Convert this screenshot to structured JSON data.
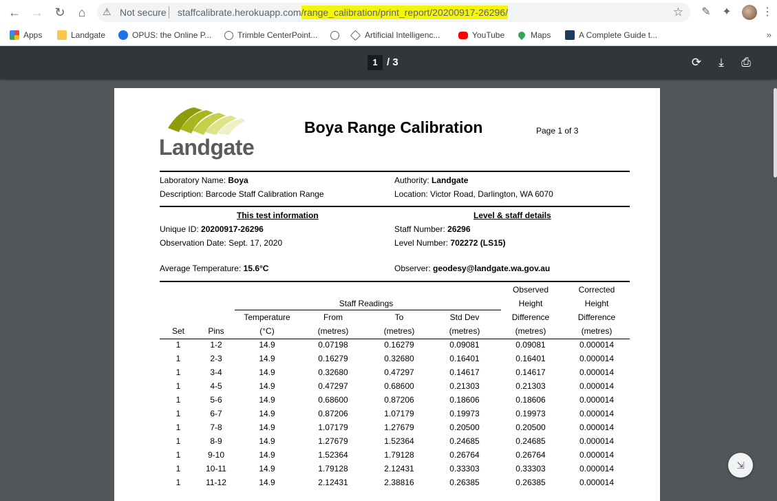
{
  "browser": {
    "security_label": "Not secure",
    "url_host": "staffcalibrate.herokuapp.com",
    "url_path": "/range_calibration/print_report/20200917-26296/",
    "bookmarks": [
      {
        "label": "Apps",
        "color": "#ea4335"
      },
      {
        "label": "Landgate",
        "color": "#f9c74f"
      },
      {
        "label": "OPUS: the Online P...",
        "color": "#1a73e8"
      },
      {
        "label": "Trimble CenterPoint...",
        "color": "#5f6368"
      },
      {
        "label": "",
        "color": "#5f6368"
      },
      {
        "label": "Artificial Intelligenc...",
        "color": "#5f6368"
      },
      {
        "label": "YouTube",
        "color": "#ff0000"
      },
      {
        "label": "Maps",
        "color": "#34a853"
      },
      {
        "label": "A Complete Guide t...",
        "color": "#1f3a5f"
      }
    ],
    "bookmarks_more": "»"
  },
  "pdf_viewer": {
    "current_page": "1",
    "total_pages": "/ 3"
  },
  "report": {
    "logo_text": "Landgate",
    "title": "Boya Range Calibration",
    "page_label": "Page 1 of 3",
    "lab_name_label": "Laboratory Name:",
    "lab_name": "Boya",
    "authority_label": "Authority:",
    "authority": "Landgate",
    "description_label": "Description:",
    "description": "Barcode Staff Calibration Range",
    "location_label": "Location:",
    "location": "Victor Road, Darlington, WA 6070",
    "test_info_heading": "This test information",
    "level_staff_heading": "Level & staff details",
    "unique_id_label": "Unique ID:",
    "unique_id": "20200917-26296",
    "staff_number_label": "Staff Number:",
    "staff_number": "26296",
    "obs_date_label": "Observation Date:",
    "obs_date": "Sept. 17, 2020",
    "level_number_label": "Level Number:",
    "level_number": "702272 (LS15)",
    "avg_temp_label": "Average Temperature:",
    "avg_temp": "15.6°C",
    "observer_label": "Observer:",
    "observer": "geodesy@landgate.wa.gov.au",
    "table": {
      "staff_readings": "Staff Readings",
      "h_set": "Set",
      "h_pins": "Pins",
      "h_temp_1": "Temperature",
      "h_temp_2": "(°C)",
      "h_from_1": "From",
      "h_from_2": "(metres)",
      "h_to_1": "To",
      "h_to_2": "(metres)",
      "h_std_1": "Std Dev",
      "h_std_2": "(metres)",
      "h_obs_1": "Observed",
      "h_obs_2": "Height",
      "h_obs_3": "Difference",
      "h_obs_4": "(metres)",
      "h_cor_1": "Corrected",
      "h_cor_2": "Height",
      "h_cor_3": "Difference",
      "h_cor_4": "(metres)",
      "rows": [
        [
          "1",
          "1-2",
          "14.9",
          "0.07198",
          "0.16279",
          "0.09081",
          "0.09081",
          "0.000014"
        ],
        [
          "1",
          "2-3",
          "14.9",
          "0.16279",
          "0.32680",
          "0.16401",
          "0.16401",
          "0.000014"
        ],
        [
          "1",
          "3-4",
          "14.9",
          "0.32680",
          "0.47297",
          "0.14617",
          "0.14617",
          "0.000014"
        ],
        [
          "1",
          "4-5",
          "14.9",
          "0.47297",
          "0.68600",
          "0.21303",
          "0.21303",
          "0.000014"
        ],
        [
          "1",
          "5-6",
          "14.9",
          "0.68600",
          "0.87206",
          "0.18606",
          "0.18606",
          "0.000014"
        ],
        [
          "1",
          "6-7",
          "14.9",
          "0.87206",
          "1.07179",
          "0.19973",
          "0.19973",
          "0.000014"
        ],
        [
          "1",
          "7-8",
          "14.9",
          "1.07179",
          "1.27679",
          "0.20500",
          "0.20500",
          "0.000014"
        ],
        [
          "1",
          "8-9",
          "14.9",
          "1.27679",
          "1.52364",
          "0.24685",
          "0.24685",
          "0.000014"
        ],
        [
          "1",
          "9-10",
          "14.9",
          "1.52364",
          "1.79128",
          "0.26764",
          "0.26764",
          "0.000014"
        ],
        [
          "1",
          "10-11",
          "14.9",
          "1.79128",
          "2.12431",
          "0.33303",
          "0.33303",
          "0.000014"
        ],
        [
          "1",
          "11-12",
          "14.9",
          "2.12431",
          "2.38816",
          "0.26385",
          "0.26385",
          "0.000014"
        ]
      ]
    }
  }
}
